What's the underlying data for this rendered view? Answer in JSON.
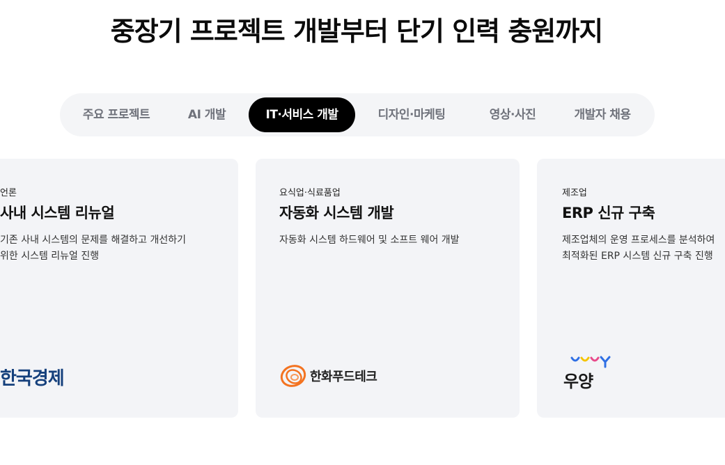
{
  "headline": "중장기 프로젝트 개발부터 단기 인력 충원까지",
  "tabs": [
    {
      "label": "주요 프로젝트",
      "active": false
    },
    {
      "label": "AI 개발",
      "active": false
    },
    {
      "label": "IT·서비스 개발",
      "active": true
    },
    {
      "label": "디자인·마케팅",
      "active": false
    },
    {
      "label": "영상·사진",
      "active": false
    },
    {
      "label": "개발자 채용",
      "active": false
    }
  ],
  "cards": [
    {
      "category": "언론",
      "title": "사내 시스템 리뉴얼",
      "description": "기존 사내 시스템의 문제를 해결하고 개선하기\n위한 시스템 리뉴얼 진행",
      "client_logo": "한국경제"
    },
    {
      "category": "요식업·식료품업",
      "title": "자동화 시스템 개발",
      "description": "자동화 시스템 하드웨어 및 소프트 웨어 개발",
      "client_logo": "한화푸드테크"
    },
    {
      "category": "제조업",
      "title": "ERP 신규 구축",
      "description": "제조업체의 운영 프로세스를 분석하여\n최적화된 ERP 시스템 신규 구축 진행",
      "client_logo": "우양"
    }
  ],
  "colors": {
    "tab_bar_bg": "#f4f5f7",
    "tab_active_bg": "#000000",
    "card_bg": "#f3f4f7",
    "hanwha_orange": "#f37321",
    "wooyang_blue": "#2f6fe4",
    "wooyang_yellow": "#f5c400",
    "wooyang_pink": "#e84a8a"
  },
  "icons": [
    "hanwha-logo-icon",
    "wooyang-logo-icon"
  ]
}
